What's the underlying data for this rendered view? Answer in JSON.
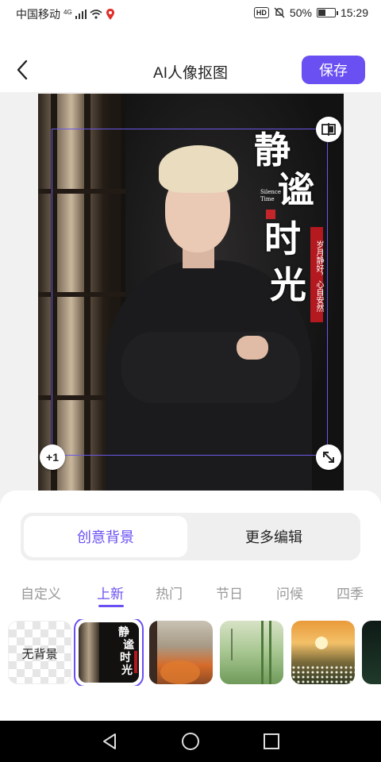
{
  "status_bar": {
    "carrier": "中国移动",
    "network": "4G",
    "battery_text": "50%",
    "battery_level": 0.5,
    "time": "15:29",
    "hd_badge": "HD"
  },
  "header": {
    "title": "AI人像抠图",
    "save_label": "保存"
  },
  "poster": {
    "title_chars": [
      "静",
      "谧",
      "时",
      "光"
    ],
    "subtitle_en": "Silence Time",
    "tag_text": "岁月静好，心自安然"
  },
  "canvas": {
    "add_label": "+1"
  },
  "segment": {
    "options": [
      "创意背景",
      "更多编辑"
    ],
    "active": "创意背景"
  },
  "categories": {
    "items": [
      "自定义",
      "上新",
      "热门",
      "节日",
      "问候",
      "四季"
    ],
    "active": "上新"
  },
  "thumbnails": {
    "no_background_label": "无背景"
  },
  "colors": {
    "accent": "#6a4ff2",
    "tag_red": "#b3191f"
  },
  "icons": {
    "back": "chevron-left-icon",
    "compare": "compare-icon",
    "resize": "resize-arrow-icon",
    "nav_back": "triangle-back-icon",
    "nav_home": "circle-home-icon",
    "nav_recent": "square-recent-icon"
  }
}
